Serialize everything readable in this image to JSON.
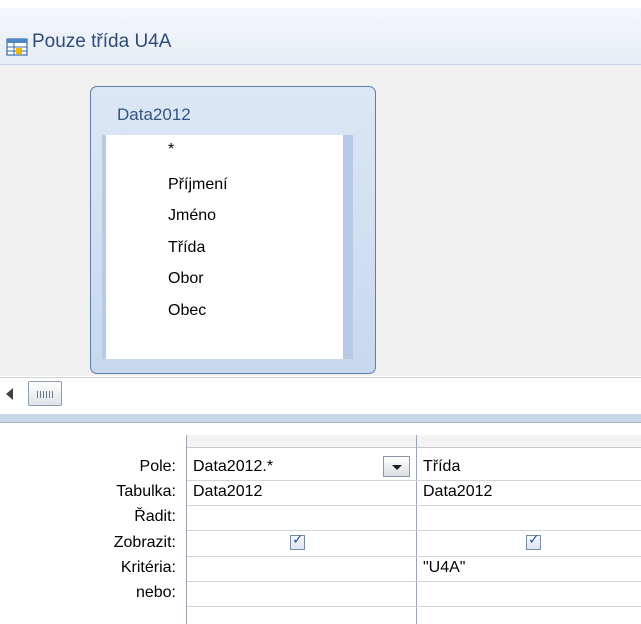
{
  "window": {
    "title": "Pouze třída U4A",
    "icon": "query-icon"
  },
  "table_box": {
    "title": "Data2012",
    "fields": [
      "*",
      "Příjmení",
      "Jméno",
      "Třída",
      "Obor",
      "Obec"
    ]
  },
  "grid": {
    "row_labels": {
      "pole": "Pole:",
      "tabulka": "Tabulka:",
      "radit": "Řadit:",
      "zobrazit": "Zobrazit:",
      "kriteria": "Kritéria:",
      "nebo": "nebo:"
    },
    "columns": [
      {
        "pole": "Data2012.*",
        "tabulka": "Data2012",
        "radit": "",
        "zobrazit": true,
        "kriteria": "",
        "nebo": ""
      },
      {
        "pole": "Třída",
        "tabulka": "Data2012",
        "radit": "",
        "zobrazit": true,
        "kriteria": "\"U4A\"",
        "nebo": ""
      }
    ],
    "check_mark": "✓"
  },
  "colors": {
    "title_text": "#2c4c7a",
    "table_header_bg": "#c7d8ee",
    "accent": "#2456a8"
  }
}
